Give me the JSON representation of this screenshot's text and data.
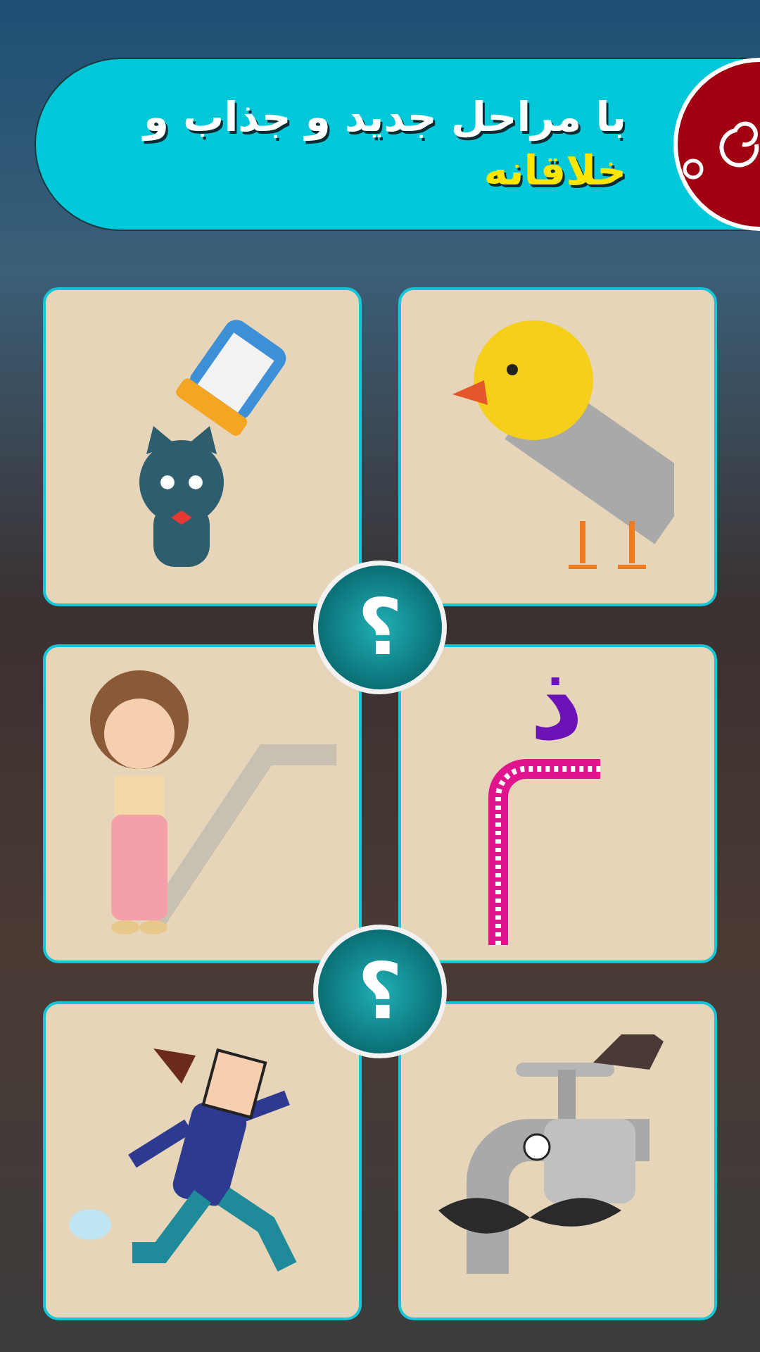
{
  "banner": {
    "lines": [
      "با مراحل جدید و جذاب و",
      "خلاقانه"
    ]
  },
  "cards": [
    {
      "kind": "cat-salt"
    },
    {
      "kind": "chick-blade"
    },
    {
      "kind": "girl-shadow"
    },
    {
      "kind": "straw-letter",
      "letter": "ذ"
    },
    {
      "kind": "running-man"
    },
    {
      "kind": "faucet-face"
    }
  ],
  "hint_badges": [
    {
      "symbol": "؟"
    },
    {
      "symbol": "؟"
    }
  ]
}
